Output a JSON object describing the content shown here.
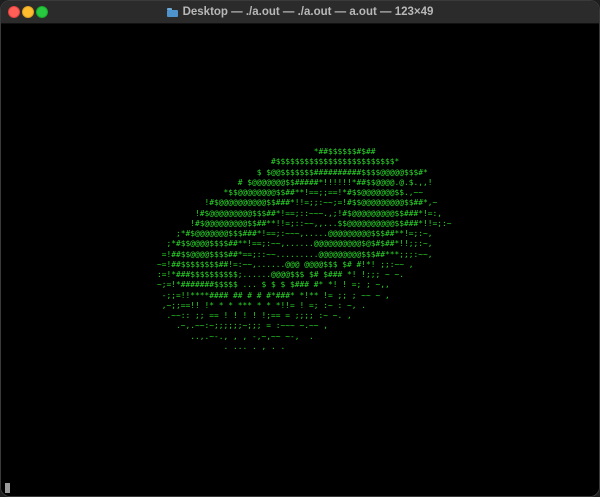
{
  "window": {
    "title": "Desktop — ./a.out — ./a.out — a.out — 123×49",
    "title_icon": "folder-icon",
    "buttons": {
      "close": "close-button",
      "minimize": "minimize-button",
      "zoom": "zoom-button"
    }
  },
  "terminal": {
    "text_color": "#2ad62a",
    "background": "#000000",
    "output": "                                                                 *##$$$$$$#$##\n                                                        #$$$$$$$$$$$$$$$$$$$$$$$$$*\n                                                     $ $@@$$$$$$$##########$$$$@@@@@$$$#*\n                                                 # $@@@@@@@$$#####*!!!!!!*##$$@@@@.@.$.,,!\n                                              *$$@@@@@@@@$$##**!==;;==!*#$$@@@@@@@$$.,~~\n                                          !#$@@@@@@@@@@$$###*!!=;;:~~;=!#$$@@@@@@@@@$$##*,~\n                                        !#$@@@@@@@@@$$$##*!==;::~~~.,;!#$@@@@@@@@@$$###*!=:,\n                                       !#$@@@@@@@@@$$##**!!=;::~~,,...$$@@@@@@@@@@$$###*!!=;:~\n                                    ;*#$@@@@@@@$$$###*!==;:~~~,.....@@@@@@@@@$$$##**!=;:~,\n                                  ;*#$$@@@@$$$$##**!==;:~~,......@@@@@@@@@@$@$#$##*!!;;:~,\n                                 =!##$$@@@@$$$$##*==;::~~.........@@@@@@@@@$$$##***;;;:~~,\n                                ~=!##$$$$$$$$##!=:~~,......@@@ @@@@$$$ $# #!*! ;;:~~ ,\n                                :=!*###$$$$$$$$$$;......@@@@$$$ $# $### *! !;;; ~ ~.\n                                ~;=!*#######$$$$$ ... $ $ $ $### #* *! ! =; ; ~,,\n                                 -;;=!!****#### ## # # #*###* *!** != ;; ; ~~ ~ ,\n                                 ,~;;==!! !* * * *** * * *!!= ! =; :~ : ~, .\n                                  .~~:: ;; == ! ! ! ! !;== = ;;;; :~ ~. ,\n                                    .~,.~~:~;;;;;;~;;; = :~~~ ~.~~ ,\n                                       ..,.~-., , , -,~,~~ ~-,  .\n                                              . ... . , . ."
  }
}
